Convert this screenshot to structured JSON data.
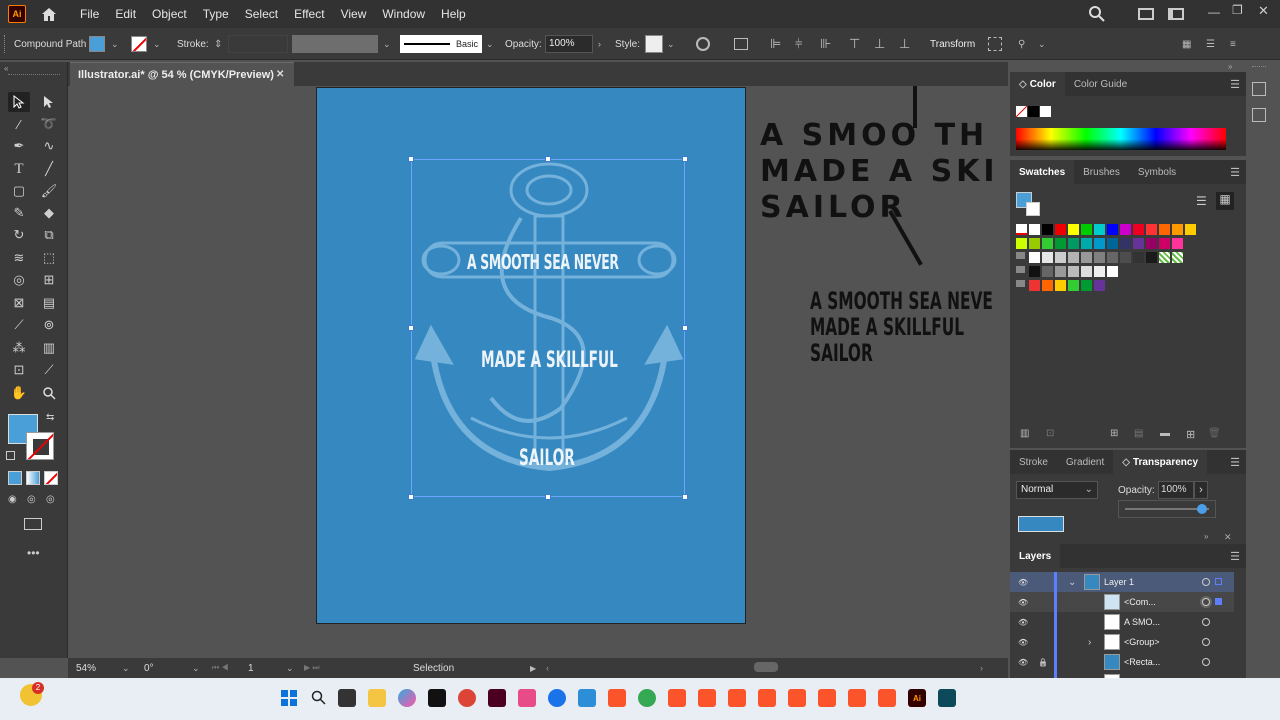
{
  "app": {
    "logo_text": "Ai"
  },
  "menu": [
    "File",
    "Edit",
    "Object",
    "Type",
    "Select",
    "Effect",
    "View",
    "Window",
    "Help"
  ],
  "control_bar": {
    "selection_type": "Compound Path",
    "fill_color": "#4a9fd8",
    "stroke_label": "Stroke:",
    "stroke_style": "Basic",
    "opacity_label": "Opacity:",
    "opacity_value": "100%",
    "style_label": "Style:",
    "transform_label": "Transform"
  },
  "document": {
    "tab_title": "Illustrator.ai* @ 54 % (CMYK/Preview)",
    "close_glyph": "✕",
    "artboard_color": "#3588c0"
  },
  "artwork": {
    "line1": "A SMOOTH SEA NEVER",
    "line2": "MADE A SKILLFUL",
    "line3": "SAILOR",
    "outline_text_1": "A SMOO",
    "outline_text_1b": "TH",
    "outline_text_1c": "S",
    "outline_text_2": "MADE A SKIL",
    "outline_text_3": "SAILOR",
    "side_text_1": "A SMOOTH SEA NEVER",
    "side_text_2": "MADE A SKILLFUL",
    "side_text_3": "SAILOR"
  },
  "status_bar": {
    "zoom": "54%",
    "rotation": "0°",
    "artboard_num": "1",
    "tool": "Selection"
  },
  "color_panel": {
    "tabs": [
      "Color",
      "Color Guide"
    ]
  },
  "swatches_panel": {
    "tabs": [
      "Swatches",
      "Brushes",
      "Symbols"
    ]
  },
  "transparency_panel": {
    "tabs": [
      "Stroke",
      "Gradient",
      "Transparency"
    ],
    "blend_mode": "Normal",
    "opacity_label": "Opacity:",
    "opacity_value": "100%"
  },
  "layers_panel": {
    "title": "Layers",
    "rows": [
      {
        "name": "Layer 1"
      },
      {
        "name": "<Com..."
      },
      {
        "name": "A SMO..."
      },
      {
        "name": "<Group>"
      },
      {
        "name": "<Recta..."
      },
      {
        "name": "A SMO..."
      }
    ]
  },
  "taskbar": {
    "notification_count": "2"
  }
}
